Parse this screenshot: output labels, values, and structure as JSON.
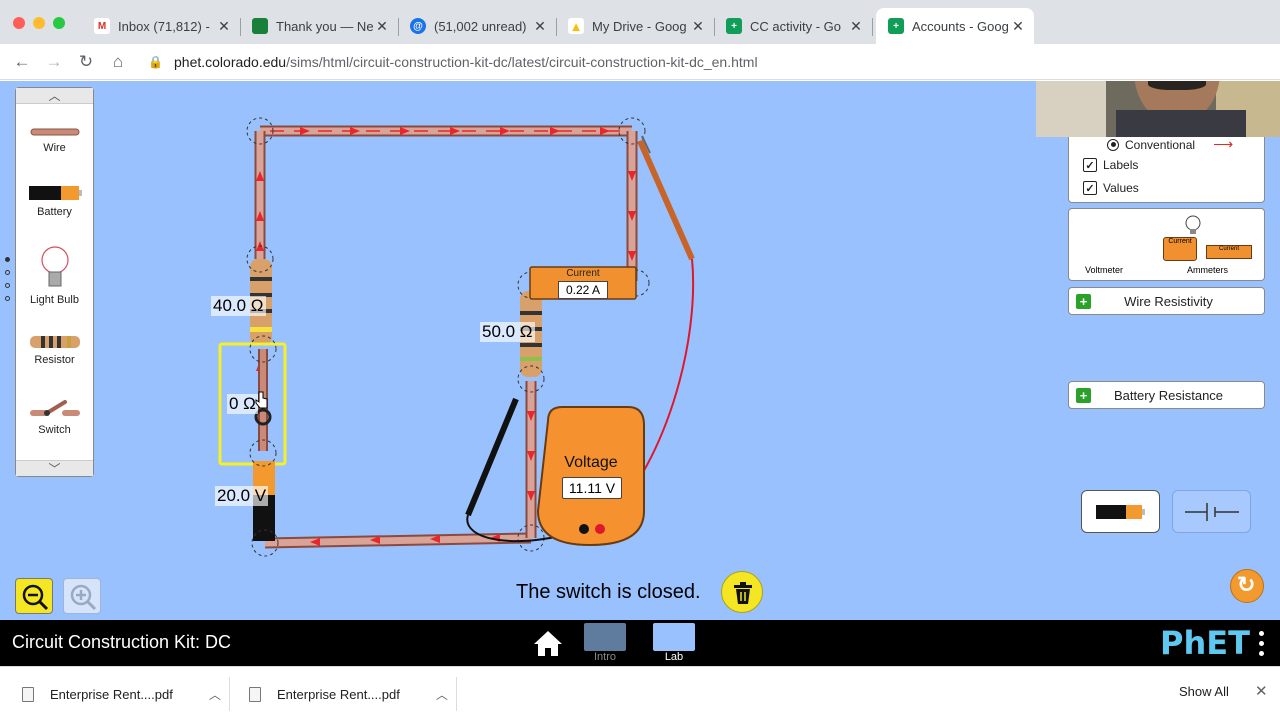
{
  "browser": {
    "tabs": [
      {
        "title": "Inbox (71,812) -",
        "fav_color": "#ffffff",
        "fav_text": "M",
        "fav_text_color": "#d93025"
      },
      {
        "title": "Thank you — Ne",
        "fav_color": "#188038",
        "fav_text": "",
        "fav_text_color": "#ffffff"
      },
      {
        "title": "(51,002 unread)",
        "fav_color": "#ffffff",
        "fav_text": "@",
        "fav_text_color": "#1a73e8"
      },
      {
        "title": "My Drive - Goog",
        "fav_color": "#ffffff",
        "fav_text": "▲",
        "fav_text_color": "#fbbc04"
      },
      {
        "title": "CC activity - Go",
        "fav_color": "#0f9d58",
        "fav_text": "+",
        "fav_text_color": "#ffffff"
      },
      {
        "title": "Accounts - Goog",
        "fav_color": "#0f9d58",
        "fav_text": "+",
        "fav_text_color": "#ffffff"
      }
    ],
    "url_host": "phet.colorado.edu",
    "url_path": "/sims/html/circuit-construction-kit-dc/latest/circuit-construction-kit-dc_en.html"
  },
  "palette": {
    "items": [
      {
        "label": "Wire",
        "icon": "wire-icon"
      },
      {
        "label": "Battery",
        "icon": "battery-icon"
      },
      {
        "label": "Light Bulb",
        "icon": "light-bulb-icon"
      },
      {
        "label": "Resistor",
        "icon": "resistor-icon"
      },
      {
        "label": "Switch",
        "icon": "switch-icon"
      }
    ]
  },
  "circuit": {
    "resistor1_label": "40.0 Ω",
    "resistor2_label": "50.0 Ω",
    "switch_label": "0 Ω",
    "battery_label": "20.0 V",
    "ammeter_title": "Current",
    "ammeter_value": "0.22 A",
    "voltmeter_title": "Voltage",
    "voltmeter_value": "11.11 V"
  },
  "options_panel": {
    "current_type": "Conventional",
    "labels": "Labels",
    "values": "Values"
  },
  "sensors_panel": {
    "voltmeter": "Voltmeter",
    "ammeters": "Ammeters",
    "ammeter_chip": "Current"
  },
  "accordions": {
    "wire_resistivity": "Wire Resistivity",
    "battery_resistance": "Battery Resistance"
  },
  "status": "The switch is closed.",
  "navbar": {
    "sim_title": "Circuit Construction Kit: DC",
    "screens": [
      "Intro",
      "Lab"
    ],
    "brand": "PhET"
  },
  "downloads": {
    "files": [
      "Enterprise Rent....pdf",
      "Enterprise Rent....pdf"
    ],
    "show_all": "Show All"
  },
  "colors": {
    "sim_background": "#99c1fe",
    "current_arrow": "#e8262b",
    "ammeter_orange": "#f0902e",
    "voltmeter_orange": "#f5922f",
    "selection_yellow": "#f5f027"
  }
}
